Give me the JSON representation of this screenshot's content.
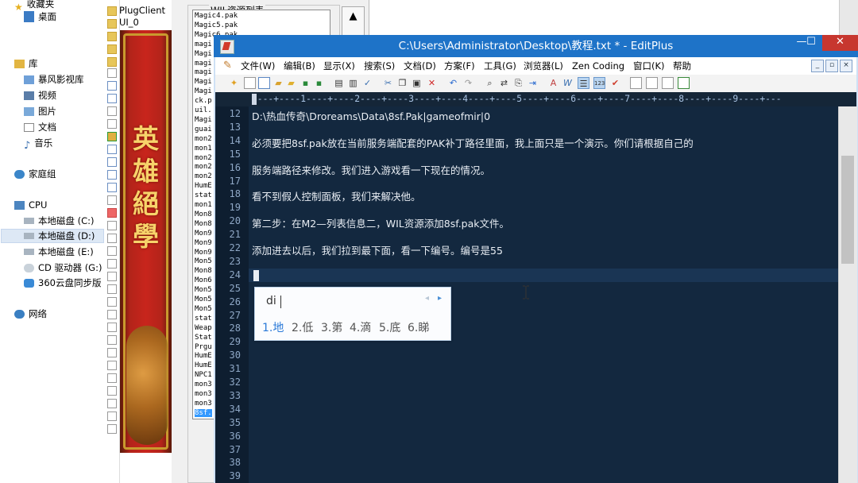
{
  "explorer": {
    "favorites": "收藏夹",
    "desktop": "桌面",
    "library": "库",
    "lib_items": [
      "暴风影视库",
      "视频",
      "图片",
      "文档",
      "音乐"
    ],
    "homegroup": "家庭组",
    "computer": "CPU",
    "drives": [
      "本地磁盘 (C:)",
      "本地磁盘 (D:)",
      "本地磁盘 (E:)",
      "CD 驱动器 (G:)",
      "360云盘同步版"
    ],
    "network": "网络"
  },
  "folders": [
    "PlugClient",
    "UI_0"
  ],
  "banner": {
    "title": "英\n雄\n絕\n學"
  },
  "resource_panel": {
    "legend": "WIL资源列表",
    "items": [
      "Magic4.pak",
      "Magic5.pak",
      "Magic6.pak",
      "magi",
      "Magi",
      "magi",
      "magi",
      "Magi",
      "Magi",
      "ck.p",
      "uil.",
      "Magi",
      "guai",
      "mon2",
      "mon1",
      "mon2",
      "mon2",
      "mon2",
      "HumE",
      "stat",
      "mon1",
      "Mon8",
      "Mon8",
      "Mon9",
      "Mon9",
      "Mon9",
      "Mon5",
      "Mon8",
      "Mon6",
      "Mon5",
      "Mon5",
      "Mon5",
      "stat",
      "Weap",
      "Stat",
      "Prgu",
      "HumE",
      "HumE",
      "NPC1",
      "mon3",
      "mon3",
      "mon3",
      "8sf."
    ],
    "selected_index": 42,
    "scroll_up": "▲"
  },
  "editplus": {
    "title": "C:\\Users\\Administrator\\Desktop\\教程.txt * - EditPlus",
    "window_buttons": {
      "minimize": "—",
      "maximize": "☐",
      "close": "✕"
    },
    "menus": [
      "文件(W)",
      "编辑(B)",
      "显示(X)",
      "搜索(S)",
      "文档(D)",
      "方案(F)",
      "工具(G)",
      "浏览器(L)",
      "Zen Coding",
      "窗口(K)",
      "帮助"
    ],
    "mdi_buttons": [
      "_",
      "▫",
      "×"
    ],
    "ruler": "----+----1----+----2----+----3----+----4----+----5----+----6----+----7----+----8----+----9----+---",
    "lines": [
      {
        "n": "12",
        "text": "D:\\热血传奇\\Droreams\\Data\\8sf.Pak|gameofmir|0"
      },
      {
        "n": "13",
        "text": ""
      },
      {
        "n": "14",
        "text": "必须要把8sf.pak放在当前服务端配套的PAK补丁路径里面，我上面只是一个演示。你们请根据自己的"
      },
      {
        "n": "15",
        "text": ""
      },
      {
        "n": "16",
        "text": "服务端路径来修改。我们进入游戏看一下现在的情况。"
      },
      {
        "n": "17",
        "text": ""
      },
      {
        "n": "18",
        "text": "看不到假人控制面板，我们来解决他。"
      },
      {
        "n": "19",
        "text": ""
      },
      {
        "n": "20",
        "text": "第二步：在M2—列表信息二，WIL资源添加8sf.pak文件。"
      },
      {
        "n": "21",
        "text": ""
      },
      {
        "n": "22",
        "text": "添加进去以后，我们拉到最下面，看一下编号。编号是55"
      },
      {
        "n": "23",
        "text": ""
      },
      {
        "n": "24",
        "text": ""
      },
      {
        "n": "25",
        "text": ""
      },
      {
        "n": "26",
        "text": ""
      },
      {
        "n": "27",
        "text": ""
      },
      {
        "n": "28",
        "text": ""
      },
      {
        "n": "29",
        "text": ""
      },
      {
        "n": "30",
        "text": ""
      },
      {
        "n": "31",
        "text": ""
      },
      {
        "n": "32",
        "text": ""
      },
      {
        "n": "33",
        "text": ""
      },
      {
        "n": "34",
        "text": ""
      },
      {
        "n": "35",
        "text": ""
      },
      {
        "n": "36",
        "text": ""
      },
      {
        "n": "37",
        "text": ""
      },
      {
        "n": "38",
        "text": ""
      },
      {
        "n": "39",
        "text": ""
      }
    ]
  },
  "ime": {
    "input": "di",
    "candidates": [
      "1.地",
      "2.低",
      "3.第",
      "4.滴",
      "5.底",
      "6.睇"
    ],
    "prev_page": "◂",
    "next_page": "▸"
  },
  "colors": {
    "titlebar": "#1e73c8",
    "editor_bg": "#13283f",
    "ime_highlight": "#2b7ad8",
    "close_button": "#c7372f"
  }
}
